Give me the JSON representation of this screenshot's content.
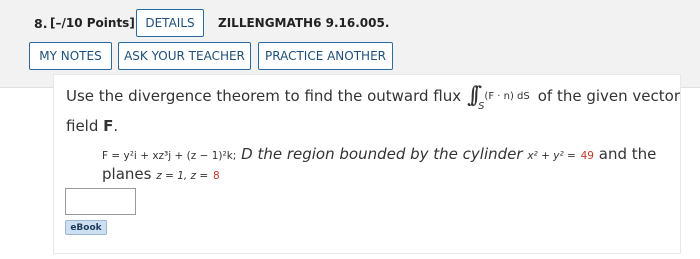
{
  "header": {
    "number": "8.",
    "points": "[–/10 Points]",
    "details_label": "DETAILS",
    "reference": "ZILLENGMATH6 9.16.005."
  },
  "actions": {
    "notes_label": "MY NOTES",
    "ask_label": "ASK YOUR TEACHER",
    "practice_label": "PRACTICE ANOTHER"
  },
  "question": {
    "intro_a": "Use the divergence theorem to find the outward flux",
    "integral_sub": "S",
    "integrand": "(F · n) dS",
    "intro_b": "of the given vector",
    "intro_c": "field",
    "field_name": "F",
    "period": ".",
    "formula_F": "F = y²i + xz³j + (z − 1)²k;",
    "region_text_a": "D the region bounded by the cylinder",
    "cylinder_eq": "x² + y² =",
    "cylinder_val": "49",
    "region_text_b": "and the",
    "planes_label": "planes",
    "planes_eq": "z = 1, z =",
    "planes_val": "8"
  },
  "answer": {
    "value": ""
  },
  "ebook_label": "eBook"
}
